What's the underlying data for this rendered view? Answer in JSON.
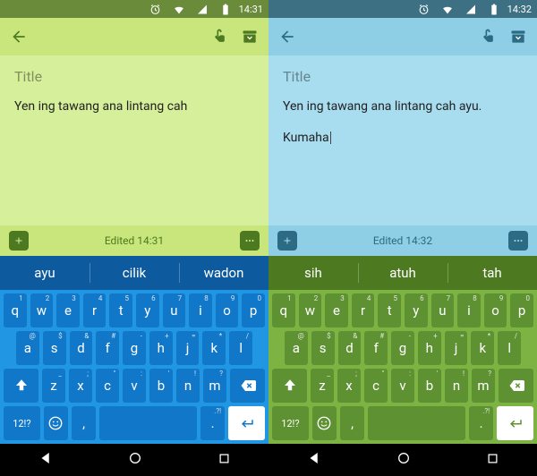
{
  "panes": [
    {
      "side": "left",
      "status_time": "14:31",
      "title_placeholder": "Title",
      "body_text": "Yen ing tawang ana lintang cah",
      "body_text2": "",
      "show_cursor": false,
      "edited_label": "Edited 14:31",
      "suggestions": [
        "ayu",
        "cilik",
        "wadon"
      ],
      "colors": {
        "status": "#6a8b3a",
        "appbar": "#c8e67c",
        "content": "#d6ef9a",
        "tint": "#4d7a21",
        "suggest": "#0d5b9e",
        "keyboard": "#2196e3",
        "key": "#1177c9"
      }
    },
    {
      "side": "right",
      "status_time": "14:32",
      "title_placeholder": "Title",
      "body_text": "Yen ing tawang ana lintang cah ayu.",
      "body_text2": "Kumaha",
      "show_cursor": true,
      "edited_label": "Edited 14:32",
      "suggestions": [
        "sih",
        "atuh",
        "tah"
      ],
      "colors": {
        "status": "#3e7084",
        "appbar": "#8fcfe5",
        "content": "#a8dcef",
        "tint": "#2c6b83",
        "suggest": "#4d7a21",
        "keyboard": "#7cb342",
        "key": "#5d9131"
      }
    }
  ],
  "keyboard": {
    "row1": [
      {
        "k": "q",
        "h": "1"
      },
      {
        "k": "w",
        "h": "2"
      },
      {
        "k": "e",
        "h": "3"
      },
      {
        "k": "r",
        "h": "4"
      },
      {
        "k": "t",
        "h": "5"
      },
      {
        "k": "y",
        "h": "6"
      },
      {
        "k": "u",
        "h": "7"
      },
      {
        "k": "i",
        "h": "8"
      },
      {
        "k": "o",
        "h": "9"
      },
      {
        "k": "p",
        "h": "0"
      }
    ],
    "row2": [
      {
        "k": "a",
        "h": "@"
      },
      {
        "k": "s",
        "h": "$"
      },
      {
        "k": "d",
        "h": "&"
      },
      {
        "k": "f",
        "h": "#"
      },
      {
        "k": "g",
        "h": "-"
      },
      {
        "k": "h",
        "h": "+"
      },
      {
        "k": "j",
        "h": "="
      },
      {
        "k": "k",
        "h": "*"
      },
      {
        "k": "l",
        "h": "/"
      }
    ],
    "row3": [
      {
        "k": "z",
        "h": "_"
      },
      {
        "k": "x",
        "h": ";"
      },
      {
        "k": "c",
        "h": "\""
      },
      {
        "k": "v",
        "h": ":"
      },
      {
        "k": "b",
        "h": "'"
      },
      {
        "k": "n",
        "h": "!"
      },
      {
        "k": "m",
        "h": "?"
      }
    ],
    "mode_key": "12!?",
    "comma": ",",
    "period": ".",
    "period_hint": ".?!"
  }
}
